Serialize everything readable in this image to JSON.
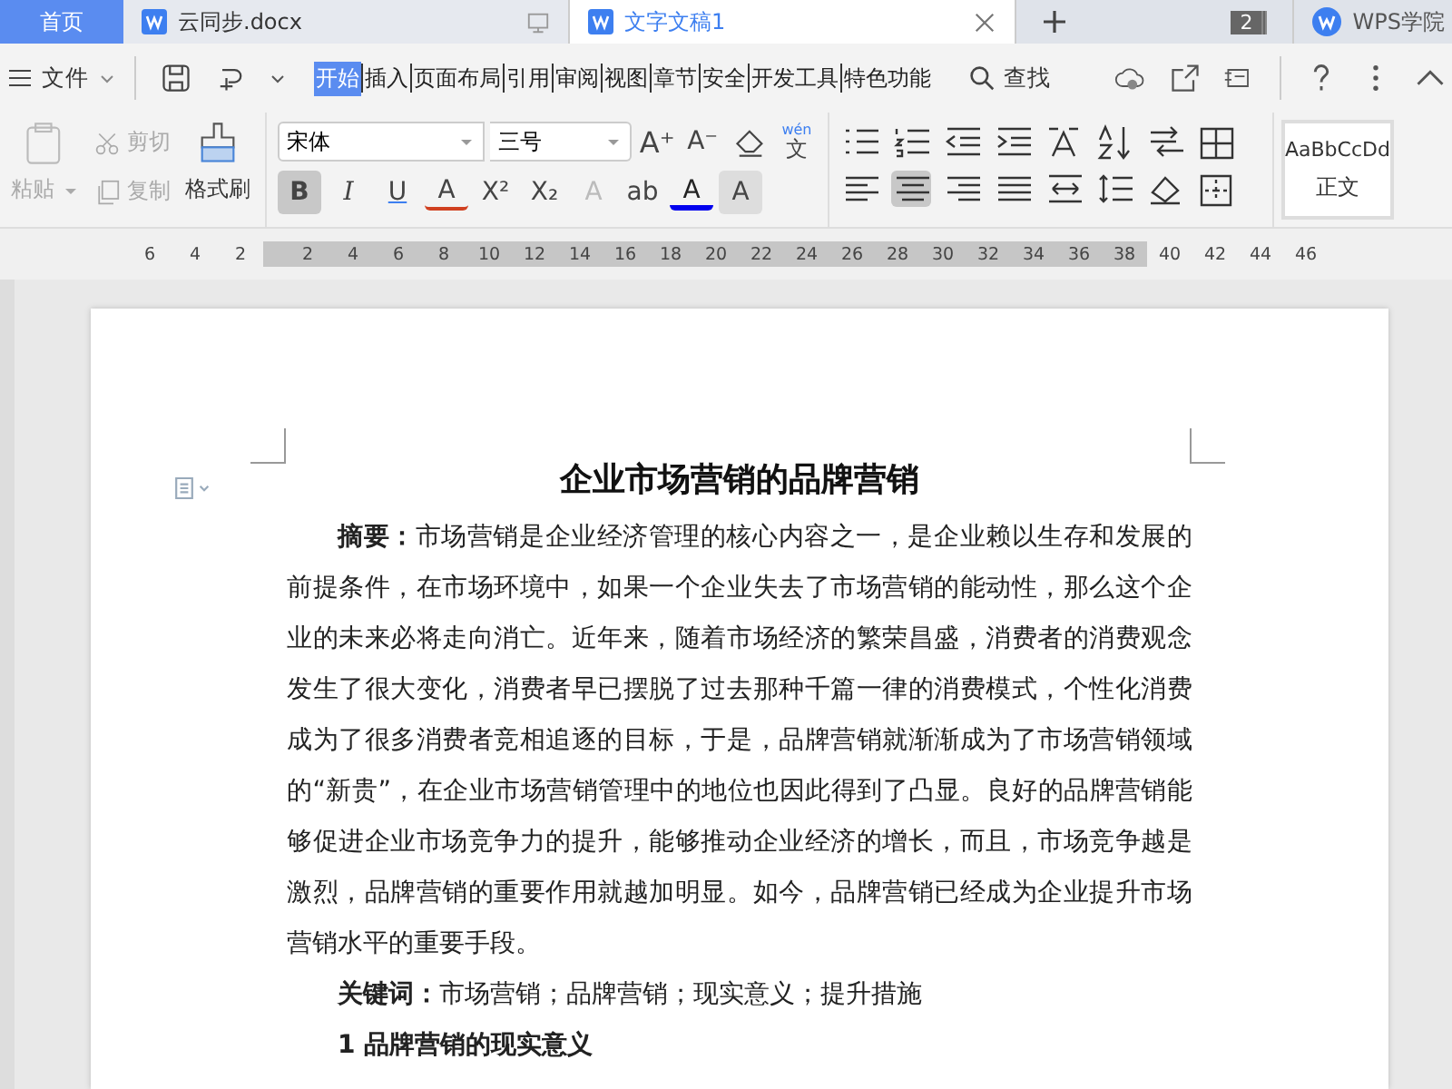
{
  "tabs": [
    {
      "kind": "home",
      "label": "首页",
      "selected": false
    },
    {
      "kind": "doc",
      "label": "云同步.docx",
      "selected": false
    },
    {
      "kind": "doc",
      "label": "文字文稿1",
      "selected": true
    }
  ],
  "window_count": "2",
  "account_button": "WPS学院",
  "menu": {
    "file": "文件",
    "ribbon_tabs": [
      {
        "label": "开始",
        "selected": true
      },
      {
        "label": "插入",
        "selected": false
      },
      {
        "label": "页面布局",
        "selected": false
      },
      {
        "label": "引用",
        "selected": false
      },
      {
        "label": "审阅",
        "selected": false
      },
      {
        "label": "视图",
        "selected": false
      },
      {
        "label": "章节",
        "selected": false
      },
      {
        "label": "安全",
        "selected": false
      },
      {
        "label": "开发工具",
        "selected": false
      },
      {
        "label": "特色功能",
        "selected": false
      }
    ],
    "search": "查找"
  },
  "clipboard": {
    "paste": {
      "label": "粘贴",
      "disabled": true
    },
    "cut": {
      "label": "剪切",
      "disabled": true
    },
    "copy": {
      "label": "复制",
      "disabled": true
    },
    "format_painter": {
      "label": "格式刷",
      "disabled": false
    }
  },
  "font": {
    "family": "宋体",
    "size": "三号",
    "size_buttons": [
      {
        "kind": "grow",
        "glyph": "A⁺"
      },
      {
        "kind": "shrink",
        "glyph": "A⁻"
      }
    ],
    "phonetic": {
      "top": "wén",
      "glyph": "文"
    },
    "format_buttons": [
      {
        "kind": "bold",
        "glyph": "B",
        "selected": true
      },
      {
        "kind": "italic",
        "glyph": "I",
        "selected": false
      },
      {
        "kind": "underline",
        "glyph": "U",
        "selected": false
      },
      {
        "kind": "strike",
        "glyph": "A",
        "selected": false
      },
      {
        "kind": "superscript",
        "glyph": "X²",
        "selected": false
      },
      {
        "kind": "subscript",
        "glyph": "X₂",
        "selected": false
      },
      {
        "kind": "effect",
        "glyph": "A",
        "selected": false
      },
      {
        "kind": "highlight",
        "glyph": "ab",
        "selected": false
      },
      {
        "kind": "color",
        "glyph": "A",
        "selected": false
      },
      {
        "kind": "shade",
        "glyph": "A",
        "selected": false
      }
    ]
  },
  "paragraph": {
    "row_1": [
      {
        "kind": "bullets",
        "selected": false
      },
      {
        "kind": "numbering",
        "selected": false
      },
      {
        "kind": "outdent",
        "selected": false
      },
      {
        "kind": "indent",
        "selected": false
      },
      {
        "kind": "direction",
        "selected": false
      },
      {
        "kind": "sort",
        "selected": false
      },
      {
        "kind": "convert",
        "selected": false
      },
      {
        "kind": "table",
        "selected": false
      }
    ],
    "row_2": [
      {
        "kind": "left",
        "selected": false
      },
      {
        "kind": "center",
        "selected": true
      },
      {
        "kind": "right",
        "selected": false
      },
      {
        "kind": "justify",
        "selected": false
      },
      {
        "kind": "distribute",
        "selected": false
      },
      {
        "kind": "spacing",
        "selected": false
      },
      {
        "kind": "fill",
        "selected": false
      },
      {
        "kind": "border",
        "selected": false
      }
    ]
  },
  "style_gallery": {
    "preview": "AaBbCcDd",
    "name": "正文"
  },
  "ruler": {
    "left_ticks": [
      "6",
      "4",
      "2"
    ],
    "ticks": [
      "2",
      "4",
      "6",
      "8",
      "10",
      "12",
      "14",
      "16",
      "18",
      "20",
      "22",
      "24",
      "26",
      "28",
      "30",
      "32",
      "34",
      "36",
      "38"
    ],
    "right_ticks": [
      "40",
      "42",
      "44",
      "46"
    ]
  },
  "document": {
    "title": "企业市场营销的品牌营销",
    "abstract": {
      "label": "摘要：",
      "text": "市场营销是企业经济管理的核心内容之一，是企业赖以生存和发展的前提条件，在市场环境中，如果一个企业失去了市场营销的能动性，那么这个企业的未来必将走向消亡。近年来，随着市场经济的繁荣昌盛，消费者的消费观念发生了很大变化，消费者早已摆脱了过去那种千篇一律的消费模式，个性化消费成为了很多消费者竞相追逐的目标，于是，品牌营销就渐渐成为了市场营销领域的“新贵”，在企业市场营销管理中的地位也因此得到了凸显。良好的品牌营销能够促进企业市场竞争力的提升，能够推动企业经济的增长，而且，市场竞争越是激烈，品牌营销的重要作用就越加明显。如今，品牌营销已经成为企业提升市场营销水平的重要手段。"
    },
    "keywords": {
      "label": "关键词：",
      "text": "市场营销；品牌营销；现实意义；提升措施"
    },
    "heading": "1 品牌营销的现实意义"
  }
}
